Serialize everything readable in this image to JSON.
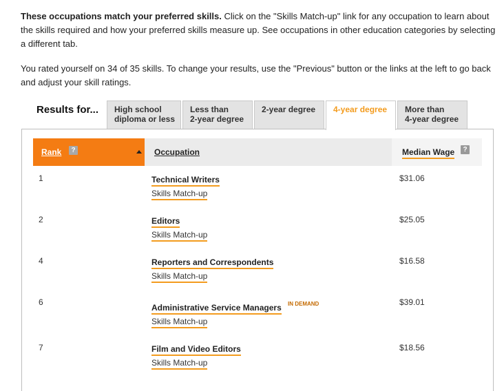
{
  "intro": {
    "bold": "These occupations match your preferred skills.",
    "rest": " Click on the \"Skills Match-up\" link for any occupation to learn about the skills required and how your preferred skills measure up. See occupations in other education categories by selecting a different tab."
  },
  "rated_text": "You rated yourself on 34 of 35 skills. To change your results, use the \"Previous\" button or the links at the left to go back and adjust your skill ratings.",
  "results_label": "Results for...",
  "tabs": [
    {
      "line1": "High school",
      "line2": "diploma or less"
    },
    {
      "line1": "Less than",
      "line2": "2-year degree"
    },
    {
      "line1": "2-year degree",
      "line2": ""
    },
    {
      "line1": "4-year degree",
      "line2": ""
    },
    {
      "line1": "More than",
      "line2": "4-year degree"
    }
  ],
  "active_tab": "4-year degree",
  "table": {
    "headers": {
      "rank": "Rank",
      "occupation": "Occupation",
      "wage": "Median Wage",
      "help": "?"
    },
    "rows": [
      {
        "rank": "1",
        "title": "Technical Writers",
        "badge": "",
        "link": "Skills Match-up",
        "wage": "$31.06"
      },
      {
        "rank": "2",
        "title": "Editors",
        "badge": "",
        "link": "Skills Match-up",
        "wage": "$25.05"
      },
      {
        "rank": "4",
        "title": "Reporters and Correspondents",
        "badge": "",
        "link": "Skills Match-up",
        "wage": "$16.58"
      },
      {
        "rank": "6",
        "title": "Administrative Service Managers",
        "badge": "IN DEMAND",
        "link": "Skills Match-up",
        "wage": "$39.01"
      },
      {
        "rank": "7",
        "title": "Film and Video Editors",
        "badge": "",
        "link": "Skills Match-up",
        "wage": "$18.56"
      }
    ]
  },
  "colors": {
    "accent": "#f47c13",
    "tab_active_text": "#f39b1d",
    "header_bg": "#ebebeb"
  }
}
